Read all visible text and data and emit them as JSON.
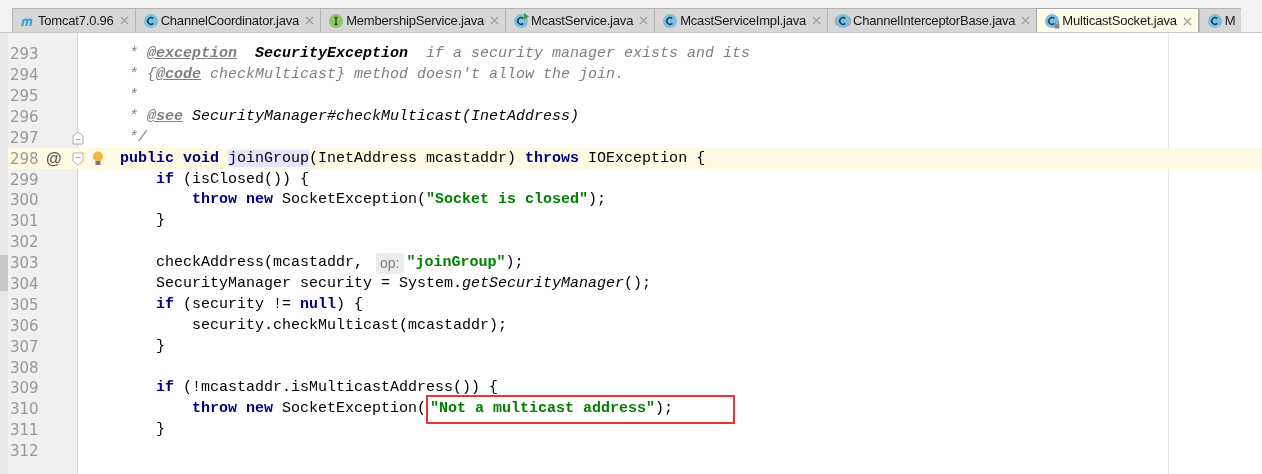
{
  "tabs": [
    {
      "label": "Tomcat7.0.96",
      "kind": "module",
      "selected": false,
      "closable": true
    },
    {
      "label": "ChannelCoordinator.java",
      "kind": "class",
      "selected": false,
      "closable": true
    },
    {
      "label": "MembershipService.java",
      "kind": "interface",
      "selected": false,
      "closable": true
    },
    {
      "label": "McastService.java",
      "kind": "runnable-class",
      "selected": false,
      "closable": true
    },
    {
      "label": "McastServiceImpl.java",
      "kind": "class",
      "selected": false,
      "closable": true
    },
    {
      "label": "ChannelInterceptorBase.java",
      "kind": "abstract-class",
      "selected": false,
      "closable": true
    },
    {
      "label": "MulticastSocket.java",
      "kind": "locked-class",
      "selected": true,
      "closable": true
    },
    {
      "label": "M",
      "kind": "class",
      "selected": false,
      "closable": false
    }
  ],
  "editor": {
    "lines": [
      {
        "number": "293",
        "segments": [
          {
            "kind": "comment",
            "text": " * "
          },
          {
            "kind": "doctag",
            "text": "@exception"
          },
          {
            "kind": "docref",
            "text": "  SecurityException"
          },
          {
            "kind": "comment",
            "text": "  if a security manager exists and its"
          }
        ]
      },
      {
        "number": "294",
        "segments": [
          {
            "kind": "comment",
            "text": " * {"
          },
          {
            "kind": "doctag",
            "text": "@code"
          },
          {
            "kind": "comment",
            "text": " checkMulticast} method doesn't allow the join."
          }
        ]
      },
      {
        "number": "295",
        "segments": [
          {
            "kind": "comment",
            "text": " *"
          }
        ]
      },
      {
        "number": "296",
        "segments": [
          {
            "kind": "comment",
            "text": " * "
          },
          {
            "kind": "doctag",
            "text": "@see"
          },
          {
            "kind": "doclink",
            "text": " SecurityManager#checkMulticast(InetAddress)"
          }
        ]
      },
      {
        "number": "297",
        "gutter_icons": [
          {
            "kind": "fold-end"
          }
        ],
        "segments": [
          {
            "kind": "comment",
            "text": " */"
          }
        ]
      },
      {
        "number": "298",
        "current": true,
        "symbol": "@",
        "gutter_icons": [
          {
            "kind": "fold-start"
          },
          {
            "kind": "intention-bulb"
          }
        ],
        "segments": [
          {
            "kind": "keyword",
            "text": "public void "
          },
          {
            "kind": "caret"
          },
          {
            "kind": "usage",
            "text": "joinGroup"
          },
          {
            "kind": "plain",
            "text": "(InetAddress mcastaddr) "
          },
          {
            "kind": "keyword",
            "text": "throws"
          },
          {
            "kind": "plain",
            "text": " IOException {"
          }
        ]
      },
      {
        "number": "299",
        "segments": [
          {
            "kind": "keyword",
            "text": "    if"
          },
          {
            "kind": "plain",
            "text": " (isClosed()) {"
          }
        ]
      },
      {
        "number": "300",
        "segments": [
          {
            "kind": "keyword",
            "text": "        throw new"
          },
          {
            "kind": "plain",
            "text": " SocketException("
          },
          {
            "kind": "string",
            "text": "\"Socket is closed\""
          },
          {
            "kind": "plain",
            "text": ");"
          }
        ]
      },
      {
        "number": "301",
        "segments": [
          {
            "kind": "plain",
            "text": "    }"
          }
        ]
      },
      {
        "number": "302"
      },
      {
        "number": "303",
        "segments": [
          {
            "kind": "plain",
            "text": "    checkAddress(mcastaddr, "
          },
          {
            "kind": "hint",
            "text": "op:"
          },
          {
            "kind": "string",
            "text": "\"joinGroup\""
          },
          {
            "kind": "plain",
            "text": ");"
          }
        ]
      },
      {
        "number": "304",
        "segments": [
          {
            "kind": "plain",
            "text": "    SecurityManager security = System."
          },
          {
            "kind": "static",
            "text": "getSecurityManager"
          },
          {
            "kind": "plain",
            "text": "();"
          }
        ]
      },
      {
        "number": "305",
        "segments": [
          {
            "kind": "keyword",
            "text": "    if"
          },
          {
            "kind": "plain",
            "text": " (security != "
          },
          {
            "kind": "keyword",
            "text": "null"
          },
          {
            "kind": "plain",
            "text": ") {"
          }
        ]
      },
      {
        "number": "306",
        "segments": [
          {
            "kind": "plain",
            "text": "        security.checkMulticast(mcastaddr);"
          }
        ]
      },
      {
        "number": "307",
        "segments": [
          {
            "kind": "plain",
            "text": "    }"
          }
        ]
      },
      {
        "number": "308"
      },
      {
        "number": "309",
        "segments": [
          {
            "kind": "keyword",
            "text": "    if"
          },
          {
            "kind": "plain",
            "text": " (!mcastaddr.isMulticastAddress()) {"
          }
        ]
      },
      {
        "number": "310",
        "segments": [
          {
            "kind": "keyword",
            "text": "        throw new"
          },
          {
            "kind": "plain",
            "text": " SocketException("
          },
          {
            "kind": "boxed",
            "segments": [
              {
                "kind": "string",
                "text": "\"Not a multicast address\""
              },
              {
                "kind": "plain",
                "text": ");"
              }
            ]
          }
        ]
      },
      {
        "number": "311",
        "segments": [
          {
            "kind": "plain",
            "text": "    }"
          }
        ]
      },
      {
        "number": "312"
      }
    ]
  }
}
